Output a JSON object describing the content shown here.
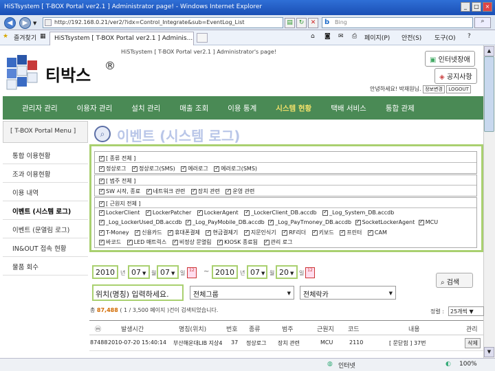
{
  "window": {
    "title": "HiSTsystem [ T-BOX Portal ver2.1 ] Administrator page! - Windows Internet Explorer",
    "address": "http://192.168.0.21/ver2/?idx=Control_Integrate&sub=EventLog_List",
    "search_placeholder": "Bing",
    "favorites_label": "즐겨찾기",
    "tab_title": "HiSTsystem [ T-BOX Portal ver2.1 ] Adminis...",
    "toolbar": [
      "페이지(P)",
      "안전(S)",
      "도구(O)"
    ],
    "status_zone": "인터넷",
    "zoom": "100%"
  },
  "header": {
    "brand": "티박스",
    "brand_mark": "®",
    "system_caption": "HiSTsystem [ T-BOX Portal ver2.1 ] Administrator's page!",
    "btn_fault": "인터넷장애",
    "btn_notice": "공지사항",
    "greeting": "안녕하세요! 박재원님.",
    "edit_info": "정보변경",
    "logout": "LOGOUT"
  },
  "menu": [
    "관리자 관리",
    "이용자 관리",
    "설치 관리",
    "매출 조회",
    "이용 통계",
    "시스템 현황",
    "택배 서비스",
    "통합 관제"
  ],
  "menu_active": 5,
  "sidebar": {
    "title": "[ T-BOX Portal Menu ]",
    "items": [
      "통합 이용현황",
      "조과 이용현황",
      "이용 내역",
      "이벤트 (시스템 로그)",
      "이벤트 (문열림 로그)",
      "IN&OUT 접속 현황",
      "물품 회수"
    ],
    "active": 3
  },
  "page_title": "이벤트 (시스템 로그)",
  "filters": {
    "type_all": "[ 종류 전체 ]",
    "types": [
      "정상로그",
      "정상로그(SMS)",
      "에러로그",
      "에러로그(SMS)"
    ],
    "category_all": "[ 범주 전체 ]",
    "categories": [
      "SW 시작, 종료",
      "네트워크 관련",
      "장치 관련",
      "운영 관련"
    ],
    "origin_all": "[ 근원지 전체 ]",
    "origins_row1": [
      "LockerClient",
      "LockerPatcher",
      "LockerAgent",
      "_LockerClient_DB.accdb",
      "_Log_System_DB.accdb"
    ],
    "origins_row2": [
      "_Log_LockerUsed_DB.accdb",
      "_Log_PayMobile_DB.accdb",
      "_Log_PayTmoney_DB.accdb",
      "SocketLockerAgent",
      "MCU"
    ],
    "origins_row3": [
      "T-Money",
      "신용카드",
      "휴대폰결제",
      "현금결제기",
      "지문인식기",
      "RF리더",
      "키보드",
      "프린터",
      "CAM"
    ],
    "origins_row4": [
      "바코드",
      "LED 매트릭스",
      "비정상 문열림",
      "KIOSK 종료됨",
      "관리 로그"
    ]
  },
  "date_range": {
    "from_year": "2010",
    "from_month": "07",
    "from_day": "07",
    "to_year": "2010",
    "to_month": "07",
    "to_day": "20",
    "unit_year": "년",
    "unit_month": "월",
    "unit_day": "일",
    "tilde": "~"
  },
  "location_input": "위치(명칭) 입력하세요.",
  "group_select": "전체그룹",
  "locker_select": "전체락카",
  "search_button": "검색",
  "result_info_prefix": "총",
  "result_count": "87,488",
  "result_info_suffix": "( 1 / 3,500 페이지 )건이 검색되었습니다.",
  "sort_label": "정렬 :",
  "sort_value": "25개씩",
  "table": {
    "headers": [
      "ⓜ",
      "발생시간",
      "명칭(위치)",
      "번호",
      "종류",
      "범주",
      "근원지",
      "코드",
      "내용",
      "관리"
    ],
    "rows": [
      [
        "87488",
        "2010-07-20 15:40:14",
        "부산해운대LIB 지상4",
        "37",
        "정상로그",
        "장치 관련",
        "MCU",
        "2110",
        "[ 문닫힘 ] 37번",
        "삭제"
      ]
    ]
  }
}
